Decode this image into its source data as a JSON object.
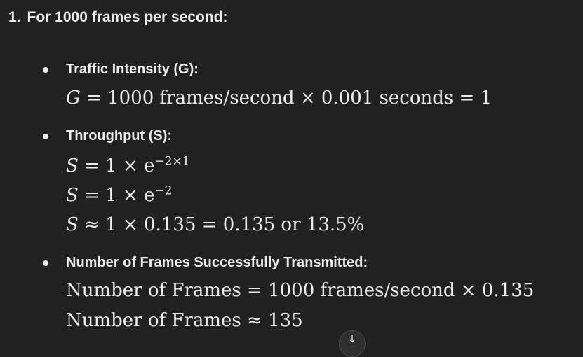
{
  "heading": {
    "number": "1.",
    "text": "For 1000 frames per second:"
  },
  "bullets": [
    {
      "title": "Traffic Intensity (G):",
      "lines": [
        {
          "var": "G",
          "rest": " = 1000 frames/second × 0.001 seconds = 1"
        }
      ]
    },
    {
      "title": "Throughput (S):",
      "lines": [
        {
          "var": "S",
          "base": " = 1 × e",
          "exp": "−2×1"
        },
        {
          "var": "S",
          "base": " = 1 × e",
          "exp": "−2"
        },
        {
          "var": "S",
          "rest": " ≈ 1 × 0.135 = 0.135 or 13.5%"
        }
      ]
    },
    {
      "title": "Number of Frames Successfully Transmitted:",
      "lines": [
        {
          "text": "Number of Frames = 1000 frames/second × 0.135"
        },
        {
          "text": "Number of Frames ≈ 135"
        }
      ]
    }
  ],
  "scroll_button": {
    "icon": "arrow-down-icon",
    "glyph": "↓"
  }
}
